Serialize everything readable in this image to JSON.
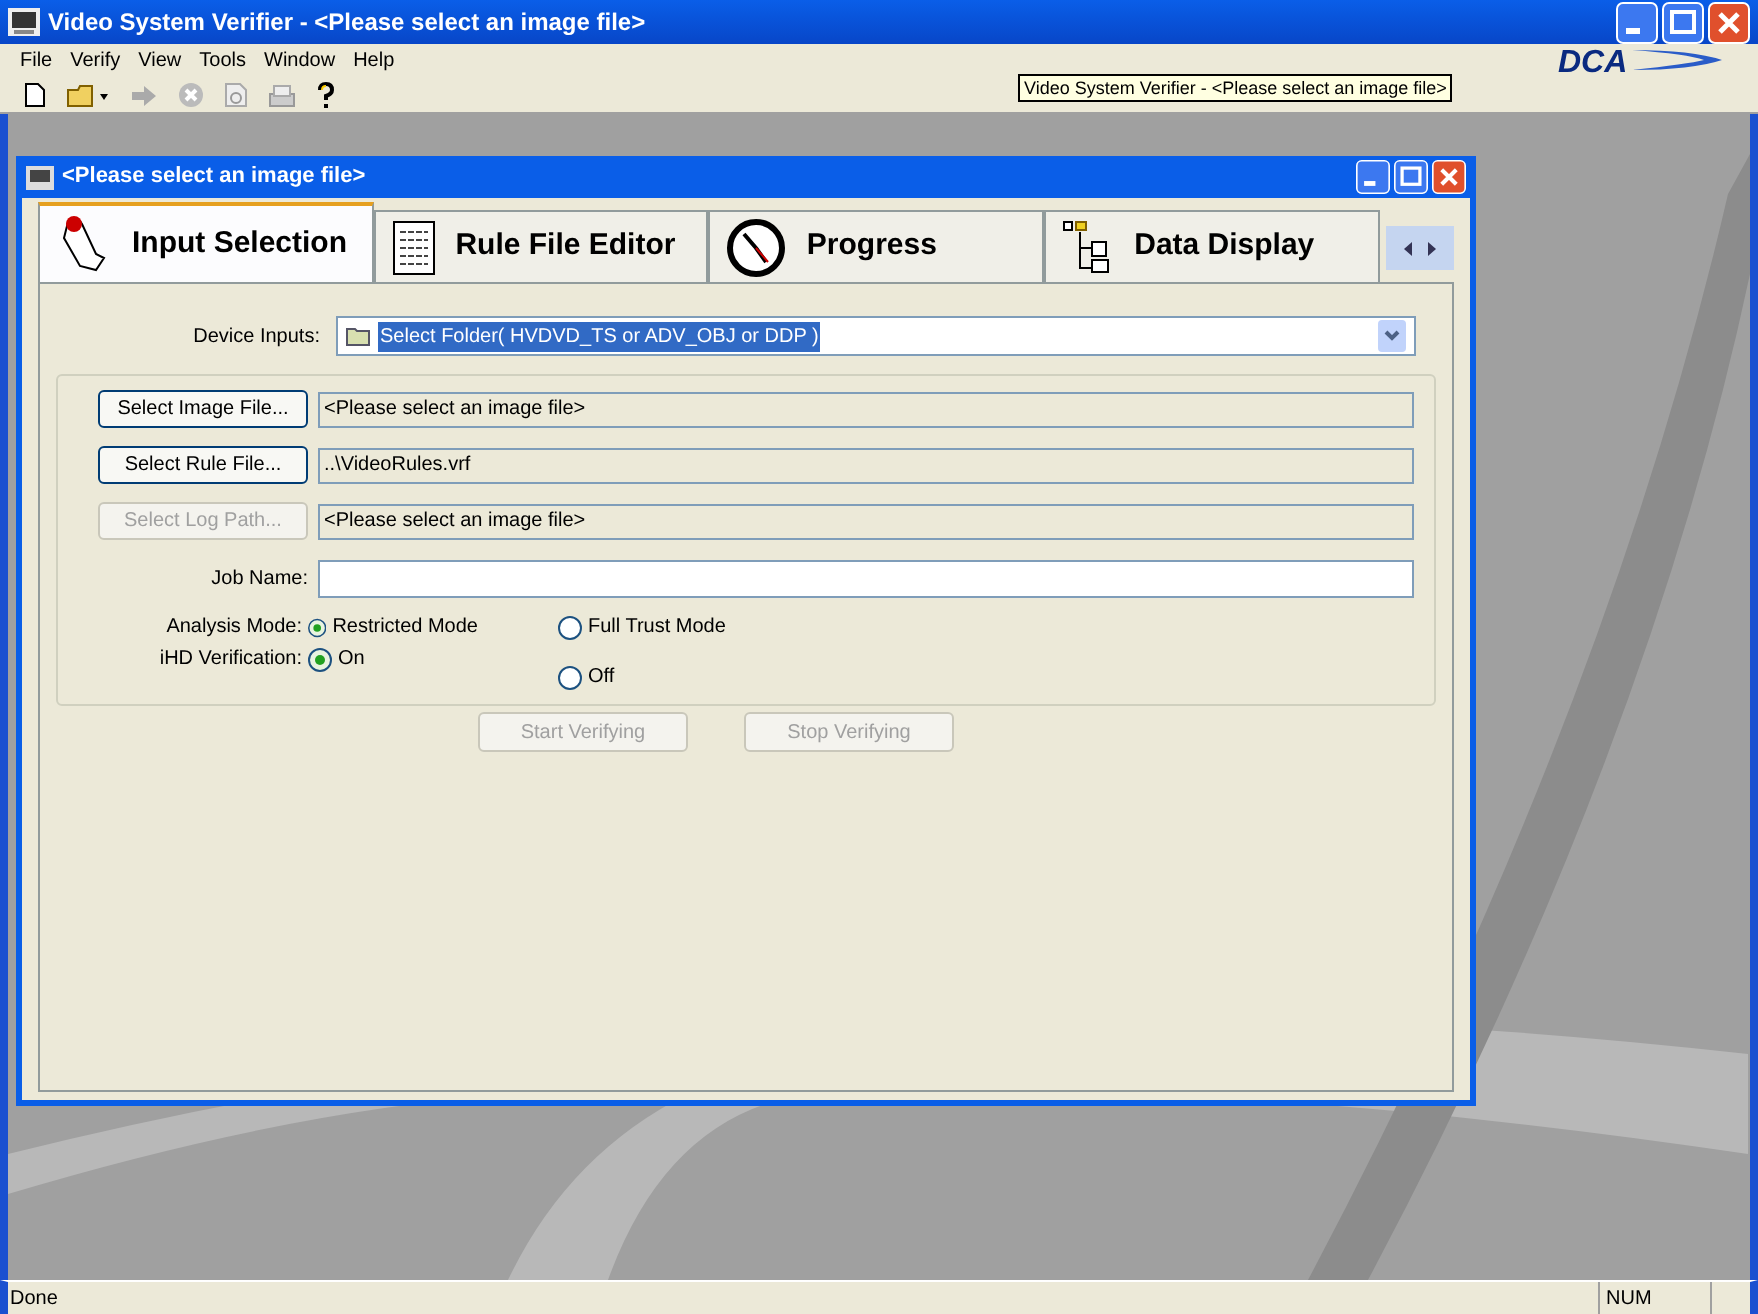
{
  "window": {
    "title": "Video System Verifier - <Please select an image file>"
  },
  "menu": [
    "File",
    "Verify",
    "View",
    "Tools",
    "Window",
    "Help"
  ],
  "tooltip": "Video System Verifier - <Please select an image file>",
  "logo": "DCA",
  "child_window": {
    "title": "<Please select an image file>",
    "tabs": [
      {
        "label": "Input Selection",
        "selected": true,
        "kind": "hand"
      },
      {
        "label": "Rule File Editor",
        "selected": false,
        "kind": "doc"
      },
      {
        "label": "Progress",
        "selected": false,
        "kind": "clock"
      },
      {
        "label": "Data Display",
        "selected": false,
        "kind": "tree"
      }
    ],
    "device_inputs": {
      "label": "Device Inputs:",
      "value": "Select Folder( HVDVD_TS or ADV_OBJ or DDP )"
    },
    "file_rows": [
      {
        "button": "Select Image File...",
        "disabled": false,
        "value": "<Please select an image file>"
      },
      {
        "button": "Select Rule File...",
        "disabled": false,
        "value": "..\\VideoRules.vrf"
      },
      {
        "button": "Select Log Path...",
        "disabled": true,
        "value": "<Please select an image file>"
      }
    ],
    "job_name": {
      "label": "Job Name:"
    },
    "radio_groups": [
      {
        "label": "Analysis Mode:",
        "options": [
          {
            "label": "Restricted Mode",
            "selected": true
          },
          {
            "label": "Full Trust Mode",
            "selected": false
          }
        ]
      },
      {
        "label": "iHD Verification:",
        "options": [
          {
            "label": "On",
            "selected": true
          },
          {
            "label": "Off",
            "selected": false
          }
        ]
      }
    ],
    "actions": [
      {
        "label": "Start Verifying",
        "disabled": true
      },
      {
        "label": "Stop Verifying",
        "disabled": true
      }
    ]
  },
  "status_bar": {
    "text": "Done",
    "indicator": "NUM"
  }
}
